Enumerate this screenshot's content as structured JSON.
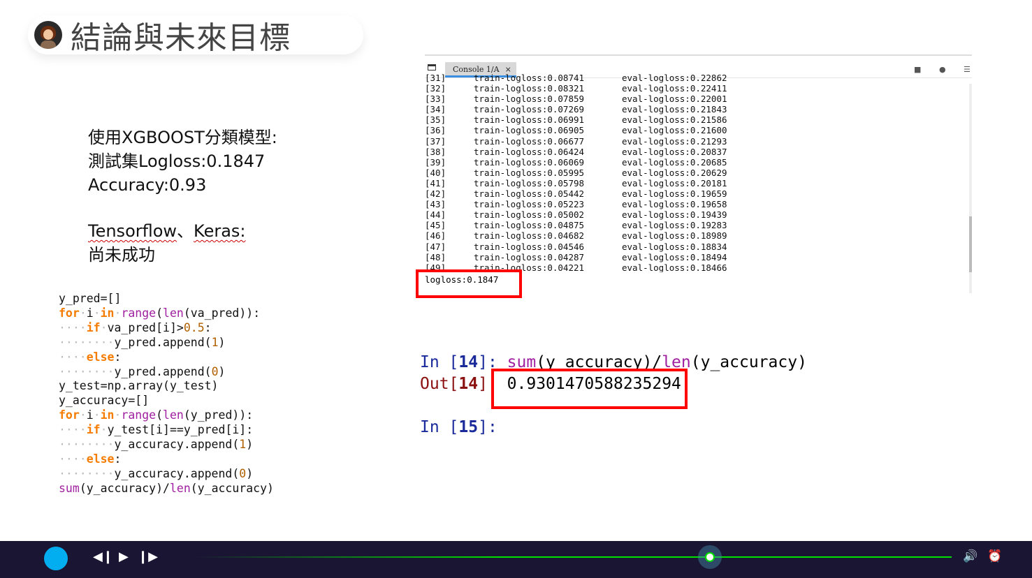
{
  "header": {
    "title": "結論與未來目標",
    "avatar": "presenter-avatar"
  },
  "summary": {
    "line1": "使用XGBOOST分類模型:",
    "line2": "測試集Logloss:0.1847",
    "line3": "Accuracy:0.93",
    "tf": "Tensorflow",
    "sep": "、",
    "keras": "Keras:",
    "line5": "尚未成功"
  },
  "console": {
    "tab_label": "Console 1/A",
    "close": "×",
    "log": [
      [
        "[31]",
        "train-logloss:0.08741",
        "eval-logloss:0.22862"
      ],
      [
        "[32]",
        "train-logloss:0.08321",
        "eval-logloss:0.22411"
      ],
      [
        "[33]",
        "train-logloss:0.07859",
        "eval-logloss:0.22001"
      ],
      [
        "[34]",
        "train-logloss:0.07269",
        "eval-logloss:0.21843"
      ],
      [
        "[35]",
        "train-logloss:0.06991",
        "eval-logloss:0.21586"
      ],
      [
        "[36]",
        "train-logloss:0.06905",
        "eval-logloss:0.21600"
      ],
      [
        "[37]",
        "train-logloss:0.06677",
        "eval-logloss:0.21293"
      ],
      [
        "[38]",
        "train-logloss:0.06424",
        "eval-logloss:0.20837"
      ],
      [
        "[39]",
        "train-logloss:0.06069",
        "eval-logloss:0.20685"
      ],
      [
        "[40]",
        "train-logloss:0.05995",
        "eval-logloss:0.20629"
      ],
      [
        "[41]",
        "train-logloss:0.05798",
        "eval-logloss:0.20181"
      ],
      [
        "[42]",
        "train-logloss:0.05442",
        "eval-logloss:0.19659"
      ],
      [
        "[43]",
        "train-logloss:0.05223",
        "eval-logloss:0.19658"
      ],
      [
        "[44]",
        "train-logloss:0.05002",
        "eval-logloss:0.19439"
      ],
      [
        "[45]",
        "train-logloss:0.04875",
        "eval-logloss:0.19283"
      ],
      [
        "[46]",
        "train-logloss:0.04682",
        "eval-logloss:0.18989"
      ],
      [
        "[47]",
        "train-logloss:0.04546",
        "eval-logloss:0.18834"
      ],
      [
        "[48]",
        "train-logloss:0.04287",
        "eval-logloss:0.18494"
      ],
      [
        "[49]",
        "train-logloss:0.04221",
        "eval-logloss:0.18466"
      ]
    ],
    "final": "logloss:0.1847"
  },
  "ipython": {
    "in14": "In [",
    "n14": "14",
    "close": "]: ",
    "fn_sum": "sum",
    "arg1": "(y_accuracy)/",
    "fn_len": "len",
    "arg2": "(y_accuracy)",
    "out14": "Out[",
    "out_close": "]:",
    "result": "0.9301470588235294",
    "in15": "In [",
    "n15": "15",
    "close15": "]:"
  },
  "code": [
    [
      [
        "",
        "y_pred=[]"
      ]
    ],
    [
      [
        "kw",
        "for"
      ],
      [
        "dot",
        "·"
      ],
      [
        "",
        "i"
      ],
      [
        "dot",
        "·"
      ],
      [
        "kw",
        "in"
      ],
      [
        "dot",
        "·"
      ],
      [
        "bi",
        "range"
      ],
      [
        "",
        "("
      ],
      [
        "bi",
        "len"
      ],
      [
        "",
        "(va_pred)):"
      ]
    ],
    [
      [
        "dot",
        "····"
      ],
      [
        "kw",
        "if"
      ],
      [
        "dot",
        "·"
      ],
      [
        "",
        "va_pred[i]>"
      ],
      [
        "num",
        "0.5"
      ],
      [
        "",
        ":"
      ]
    ],
    [
      [
        "dot",
        "········"
      ],
      [
        "",
        "y_pred.append("
      ],
      [
        "num",
        "1"
      ],
      [
        "",
        ")"
      ]
    ],
    [
      [
        "dot",
        "····"
      ],
      [
        "kw",
        "else"
      ],
      [
        "",
        ":"
      ]
    ],
    [
      [
        "dot",
        "········"
      ],
      [
        "",
        "y_pred.append("
      ],
      [
        "num",
        "0"
      ],
      [
        "",
        ")"
      ]
    ],
    [
      [
        "",
        "y_test=np.array(y_test)"
      ]
    ],
    [
      [
        "",
        "y_accuracy=[]"
      ]
    ],
    [
      [
        "kw",
        "for"
      ],
      [
        "dot",
        "·"
      ],
      [
        "",
        "i"
      ],
      [
        "dot",
        "·"
      ],
      [
        "kw",
        "in"
      ],
      [
        "dot",
        "·"
      ],
      [
        "bi",
        "range"
      ],
      [
        "",
        "("
      ],
      [
        "bi",
        "len"
      ],
      [
        "",
        "(y_pred)):"
      ]
    ],
    [
      [
        "dot",
        "····"
      ],
      [
        "kw",
        "if"
      ],
      [
        "dot",
        "·"
      ],
      [
        "",
        "y_test[i]==y_pred[i]:"
      ]
    ],
    [
      [
        "dot",
        "········"
      ],
      [
        "",
        "y_accuracy.append("
      ],
      [
        "num",
        "1"
      ],
      [
        "",
        ")"
      ]
    ],
    [
      [
        "dot",
        "····"
      ],
      [
        "kw",
        "else"
      ],
      [
        "",
        ":"
      ]
    ],
    [
      [
        "dot",
        "········"
      ],
      [
        "",
        "y_accuracy.append("
      ],
      [
        "num",
        "0"
      ],
      [
        "",
        ")"
      ]
    ],
    [
      [
        "bi",
        "sum"
      ],
      [
        "",
        "(y_accuracy)/"
      ],
      [
        "bi",
        "len"
      ],
      [
        "",
        "(y_accuracy)"
      ]
    ]
  ],
  "player": {
    "progress": 0.68,
    "accent": "#03aef0",
    "track_color": "#00e000",
    "prev": "◀❙",
    "play": "▶",
    "next": "❙▶",
    "volume": "🔊",
    "alarm": "⏰"
  }
}
